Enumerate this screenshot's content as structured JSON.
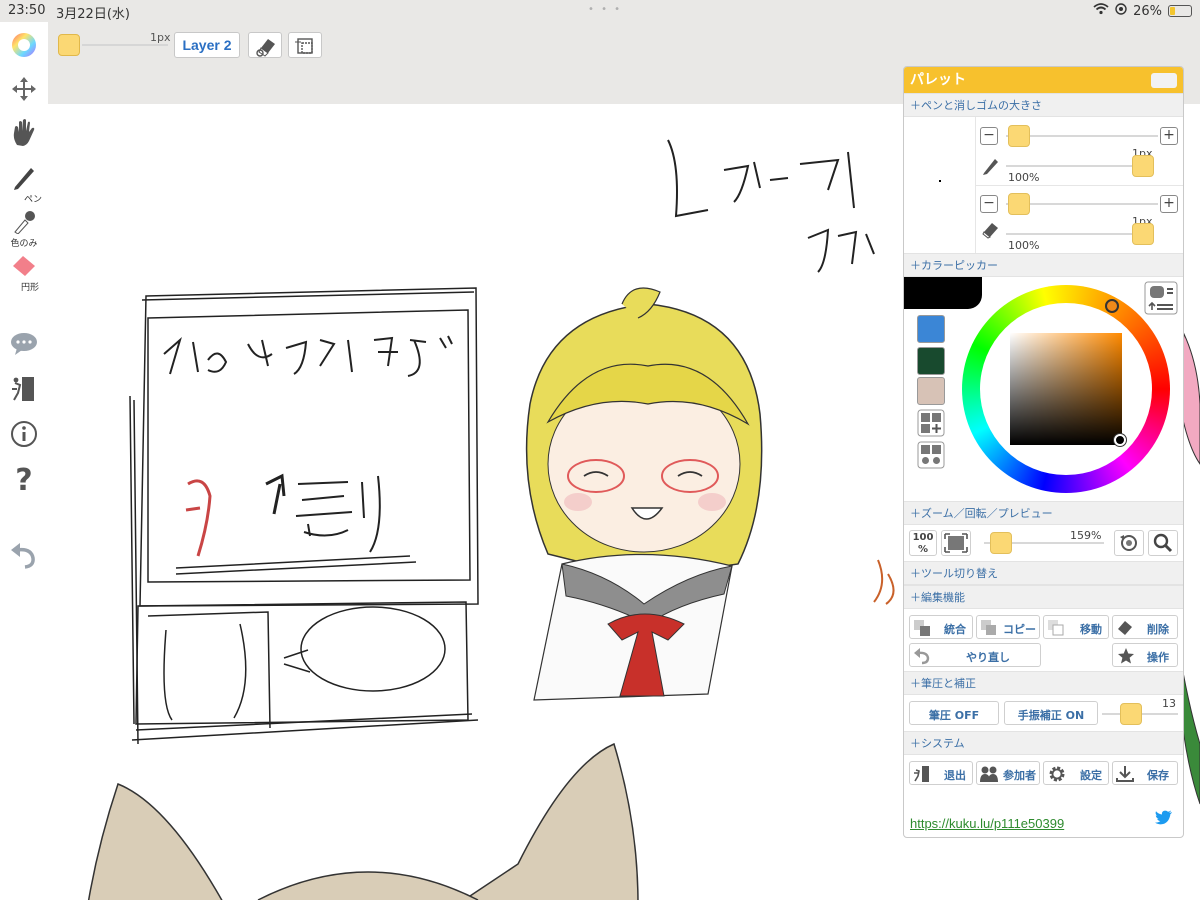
{
  "status": {
    "time": "23:50",
    "date": "3月22日(水)",
    "battery": "26%",
    "battery_level": 0.26
  },
  "toolbar": {
    "size_label": "1px",
    "layer_label": "Layer 2"
  },
  "sidebar": {
    "pen_label": "ペン",
    "picker_label": "色のみ",
    "shape_label": "円形"
  },
  "palette": {
    "title": "パレット",
    "sections": {
      "pen_eraser": "＋ペンと消しゴムの大きさ",
      "color_picker": "＋カラーピッカー",
      "zoom": "＋ズーム／回転／プレビュー",
      "tool_switch": "＋ツール切り替え",
      "edit": "＋編集機能",
      "pressure": "＋筆圧と補正",
      "system": "＋システム"
    },
    "pen": {
      "size": "1px",
      "opacity": "100%"
    },
    "eraser": {
      "size": "1px",
      "opacity": "100%"
    },
    "color_swatches": [
      "#3b86d6",
      "#184a2e",
      "#d7c2b6"
    ],
    "current_color": "#000000",
    "zoom": {
      "reset_label": "100",
      "reset_sub": "%",
      "value": "159%"
    },
    "edit_buttons": {
      "merge": "統合",
      "copy": "コピー",
      "move": "移動",
      "delete": "削除",
      "redo": "やり直し",
      "operation": "操作"
    },
    "pressure": {
      "pressure_label": "筆圧 OFF",
      "stabilize_label": "手振補正 ON",
      "value": "13"
    },
    "system_buttons": {
      "exit": "退出",
      "participants": "参加者",
      "settings": "設定",
      "save": "保存"
    },
    "link": "https://kuku.lu/p111e50399"
  }
}
